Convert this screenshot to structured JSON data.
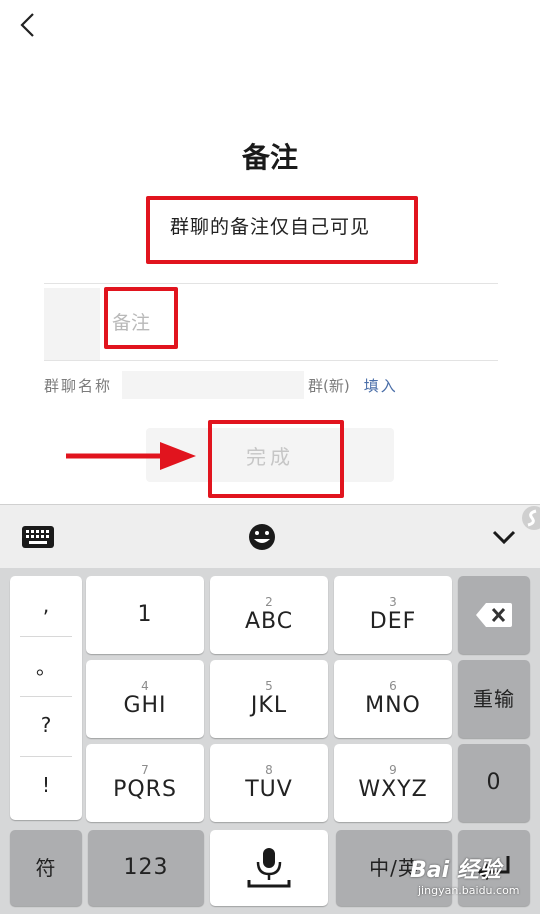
{
  "header": {
    "back_icon": "chevron-left-icon"
  },
  "page": {
    "title": "备注",
    "subtitle": "群聊的备注仅自己可见"
  },
  "remark": {
    "placeholder": "备注",
    "value": ""
  },
  "group_name": {
    "label": "群聊名称",
    "suffix": "群(新)",
    "fill_link": "填入"
  },
  "done_button": {
    "label": "完成"
  },
  "keyboard": {
    "toolbar": {
      "keyboard_icon": "keyboard-icon",
      "emoji_icon": "emoji-icon",
      "collapse_icon": "chevron-down-icon"
    },
    "punctuation": [
      ",",
      "。",
      "?",
      "!"
    ],
    "keys": [
      {
        "num": "",
        "letters": "1"
      },
      {
        "num": "2",
        "letters": "ABC"
      },
      {
        "num": "3",
        "letters": "DEF"
      },
      {
        "num": "4",
        "letters": "GHI"
      },
      {
        "num": "5",
        "letters": "JKL"
      },
      {
        "num": "6",
        "letters": "MNO"
      },
      {
        "num": "7",
        "letters": "PQRS"
      },
      {
        "num": "8",
        "letters": "TUV"
      },
      {
        "num": "9",
        "letters": "WXYZ"
      }
    ],
    "right_keys": {
      "delete_icon": "backspace-icon",
      "reinput": "重输",
      "zero": "0"
    },
    "bottom": {
      "symbol": "符",
      "numbers": "123",
      "mic_icon": "microphone-icon",
      "lang": "中/英",
      "enter_icon": "enter-icon"
    }
  },
  "watermark": {
    "main": "Bai 经验",
    "sub": "jingyan.baidu.com"
  },
  "colors": {
    "highlight": "#e1141e",
    "link": "#4a6ea8"
  }
}
